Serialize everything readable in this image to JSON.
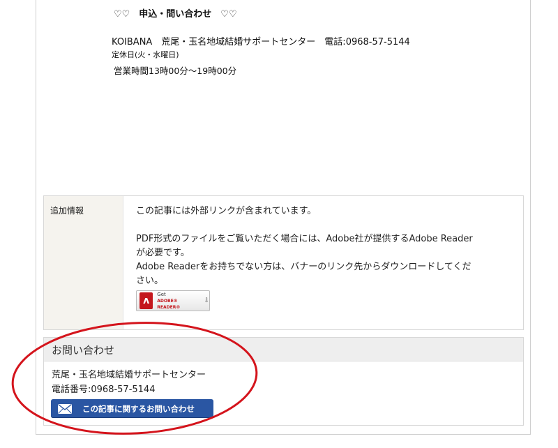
{
  "application": {
    "heading": "♡♡　申込・問い合わせ　♡♡",
    "contact_line": "KOIBANA　荒尾・玉名地域結婚サポートセンター　電話:0968-57-5144",
    "closed_days": "定休日(火・水曜日)",
    "hours": "営業時間13時00分～19時00分"
  },
  "additional_info": {
    "label": "追加情報",
    "external_link_note": "この記事には外部リンクが含まれています。",
    "pdf_note_line1": "PDF形式のファイルをご覧いただく場合には、Adobe社が提供するAdobe Reader",
    "pdf_note_line2": "が必要です。",
    "download_note_line1": "Adobe Readerをお持ちでない方は、バナーのリンク先からダウンロードしてくだ",
    "download_note_line2": "さい。",
    "banner": {
      "get": "Get",
      "product": "ADOBE® READER®",
      "icon": "adobe-pdf-icon"
    }
  },
  "inquiry": {
    "header": "お問い合わせ",
    "organization": "荒尾・玉名地域結婚サポートセンター",
    "phone": "電話番号:0968-57-5144",
    "button_label": "この記事に関するお問い合わせ",
    "button_icon": "mail-icon"
  },
  "colors": {
    "button_blue": "#2a56a3",
    "highlight_red": "#d4141c",
    "label_bg": "#f5f3ee"
  }
}
